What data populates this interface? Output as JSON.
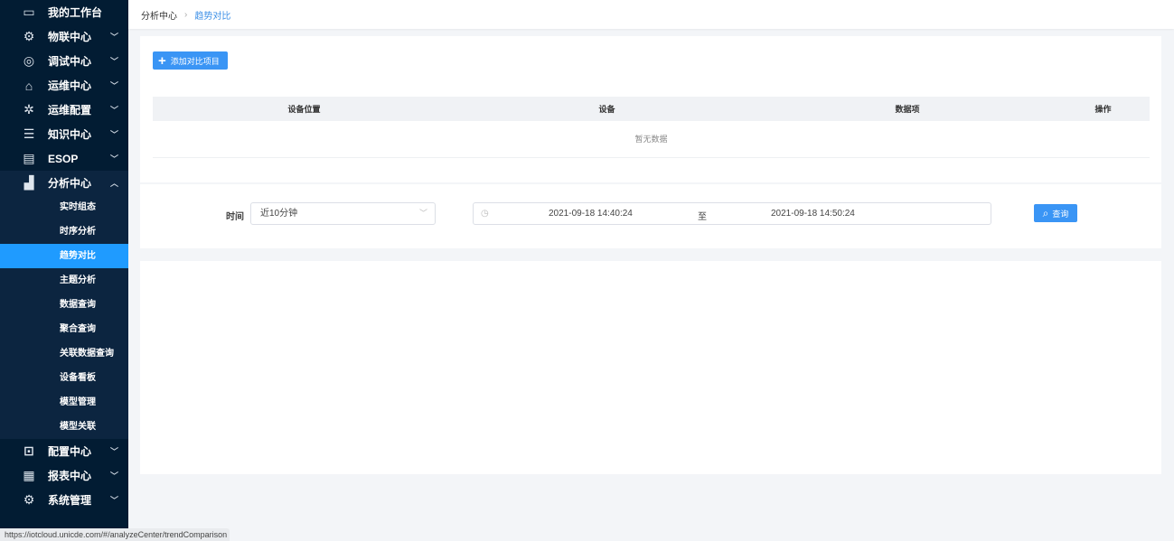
{
  "sidebar": {
    "menus_top": [
      {
        "label": "我的工作台",
        "icon": "monitor-icon",
        "glyph": "▭",
        "chev": false
      },
      {
        "label": "物联中心",
        "icon": "robot-arm-icon",
        "glyph": "⚙",
        "chev": true
      },
      {
        "label": "调试中心",
        "icon": "debug-search-icon",
        "glyph": "◎",
        "chev": true
      },
      {
        "label": "运维中心",
        "icon": "house-wrench-icon",
        "glyph": "⌂",
        "chev": true
      },
      {
        "label": "运维配置",
        "icon": "gear-icon",
        "glyph": "✲",
        "chev": true
      },
      {
        "label": "知识中心",
        "icon": "database-icon",
        "glyph": "☰",
        "chev": true
      },
      {
        "label": "ESOP",
        "icon": "esop-icon",
        "glyph": "▤",
        "chev": true
      },
      {
        "label": "分析中心",
        "icon": "bar-chart-icon",
        "glyph": "▟",
        "chev": true,
        "open": true
      }
    ],
    "submenu": [
      "实时组态",
      "时序分析",
      "趋势对比",
      "主题分析",
      "数据查询",
      "聚合查询",
      "关联数据查询",
      "设备看板",
      "模型管理",
      "模型关联"
    ],
    "active_sub": "趋势对比",
    "menus_bottom": [
      {
        "label": "配置中心",
        "icon": "toolbox-icon",
        "glyph": "⊡"
      },
      {
        "label": "报表中心",
        "icon": "report-icon",
        "glyph": "▦"
      },
      {
        "label": "系统管理",
        "icon": "gear-icon",
        "glyph": "⚙"
      }
    ]
  },
  "breadcrumb": {
    "parent": "分析中心",
    "current": "趋势对比"
  },
  "add_button": "添加对比项目",
  "table": {
    "columns": [
      "设备位置",
      "设备",
      "数据项",
      "操作"
    ],
    "empty_text": "暂无数据"
  },
  "filter": {
    "time_label": "时间",
    "time_select": "近10分钟",
    "start": "2021-09-18 14:40:24",
    "to": "至",
    "end": "2021-09-18 14:50:24",
    "query_button": "查询"
  },
  "status_url": "https://iotcloud.unicde.com/#/analyzeCenter/trendComparison",
  "colors": {
    "sidebar": "#021c33",
    "accent": "#1f9bff",
    "button": "#3a95f5"
  }
}
